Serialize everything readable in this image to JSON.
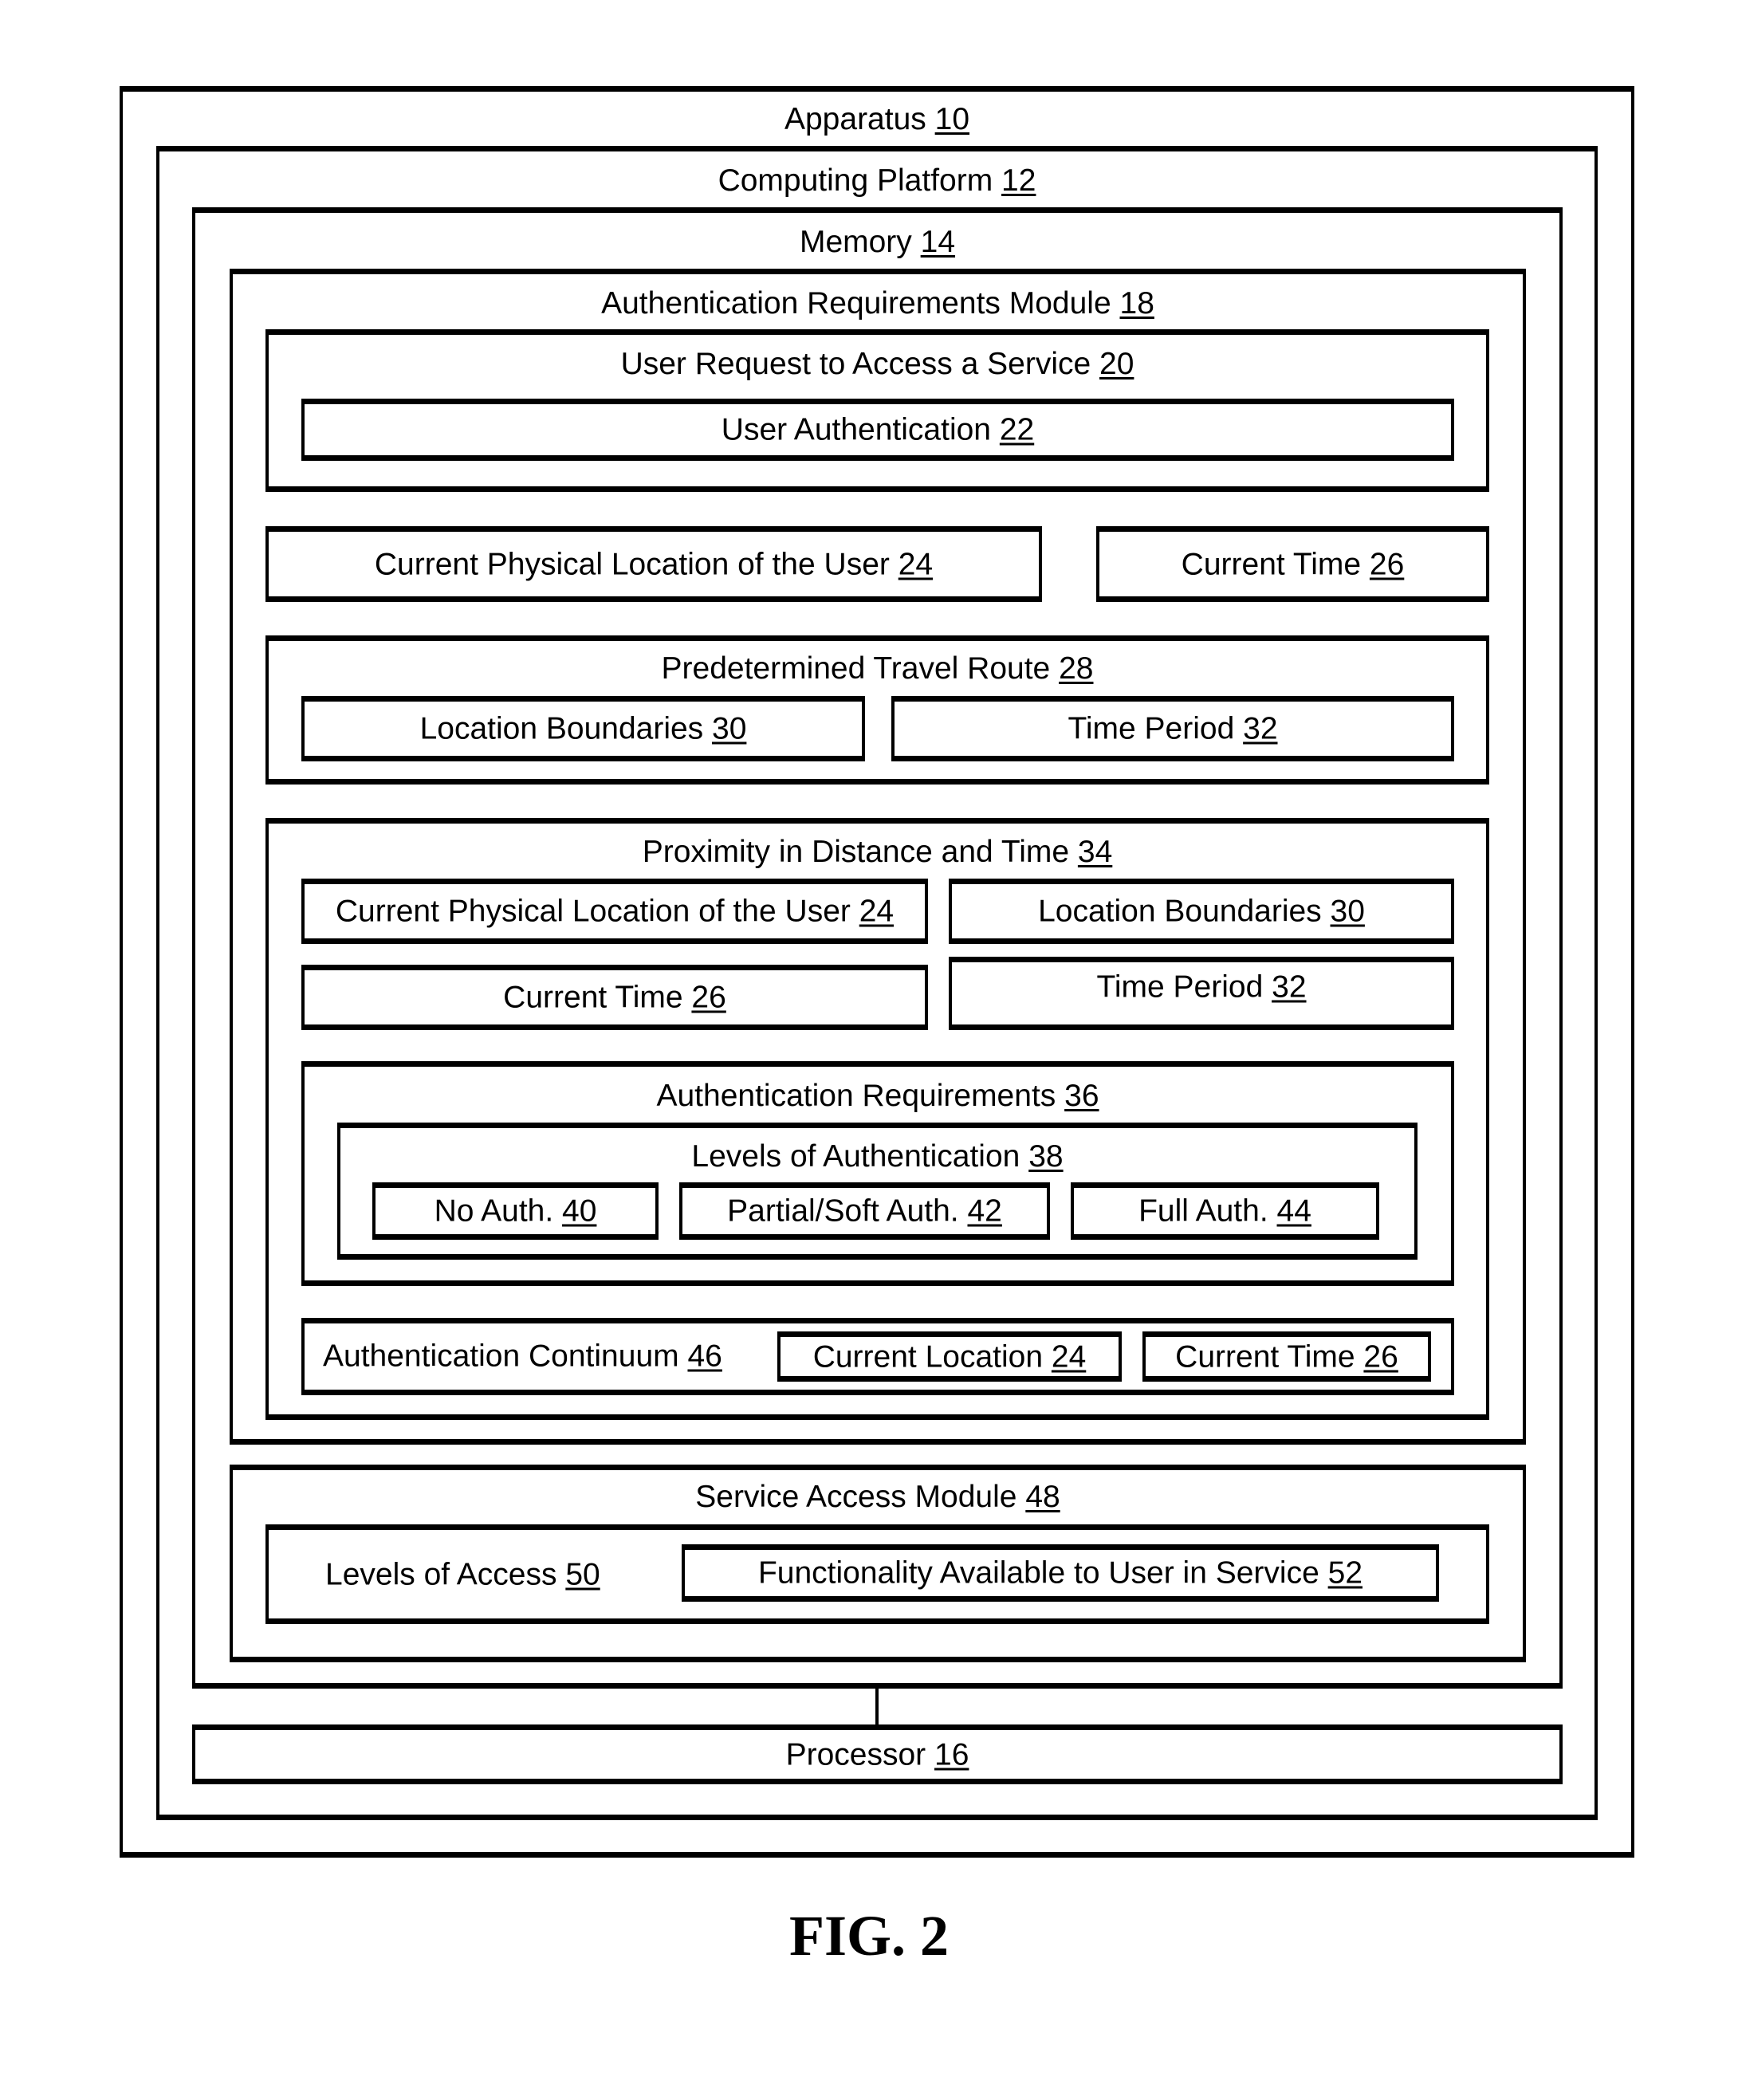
{
  "apparatus": {
    "label": "Apparatus",
    "ref": "10"
  },
  "computing_platform": {
    "label": "Computing Platform",
    "ref": "12"
  },
  "memory": {
    "label": "Memory",
    "ref": "14"
  },
  "processor": {
    "label": "Processor",
    "ref": "16"
  },
  "auth_req_module": {
    "label": "Authentication Requirements Module",
    "ref": "18",
    "user_request": {
      "label": "User Request to Access a Service",
      "ref": "20",
      "user_auth": {
        "label": "User Authentication",
        "ref": "22"
      }
    },
    "current_location": {
      "label": "Current Physical Location of the User",
      "ref": "24"
    },
    "current_time": {
      "label": "Current Time",
      "ref": "26"
    },
    "travel_route": {
      "label": "Predetermined Travel Route",
      "ref": "28",
      "location_boundaries": {
        "label": "Location Boundaries",
        "ref": "30"
      },
      "time_period": {
        "label": "Time Period",
        "ref": "32"
      }
    },
    "proximity": {
      "label": "Proximity in Distance and Time",
      "ref": "34",
      "current_location": {
        "label": "Current Physical Location of the User",
        "ref": "24"
      },
      "location_boundaries": {
        "label": "Location Boundaries",
        "ref": "30"
      },
      "current_time": {
        "label": "Current Time",
        "ref": "26"
      },
      "time_period": {
        "label": "Time Period",
        "ref": "32"
      },
      "auth_requirements": {
        "label": "Authentication Requirements",
        "ref": "36",
        "levels": {
          "label": "Levels of Authentication",
          "ref": "38",
          "no_auth": {
            "label": "No Auth.",
            "ref": "40"
          },
          "partial_auth": {
            "label": "Partial/Soft Auth.",
            "ref": "42"
          },
          "full_auth": {
            "label": "Full Auth.",
            "ref": "44"
          }
        }
      },
      "continuum": {
        "label": "Authentication Continuum",
        "ref": "46",
        "current_location": {
          "label": "Current Location",
          "ref": "24"
        },
        "current_time": {
          "label": "Current Time",
          "ref": "26"
        }
      }
    }
  },
  "service_access_module": {
    "label": "Service Access Module",
    "ref": "48",
    "levels_of_access": {
      "label": "Levels of Access",
      "ref": "50"
    },
    "functionality": {
      "label": "Functionality Available to User in Service",
      "ref": "52"
    }
  },
  "figure_label": "FIG. 2"
}
